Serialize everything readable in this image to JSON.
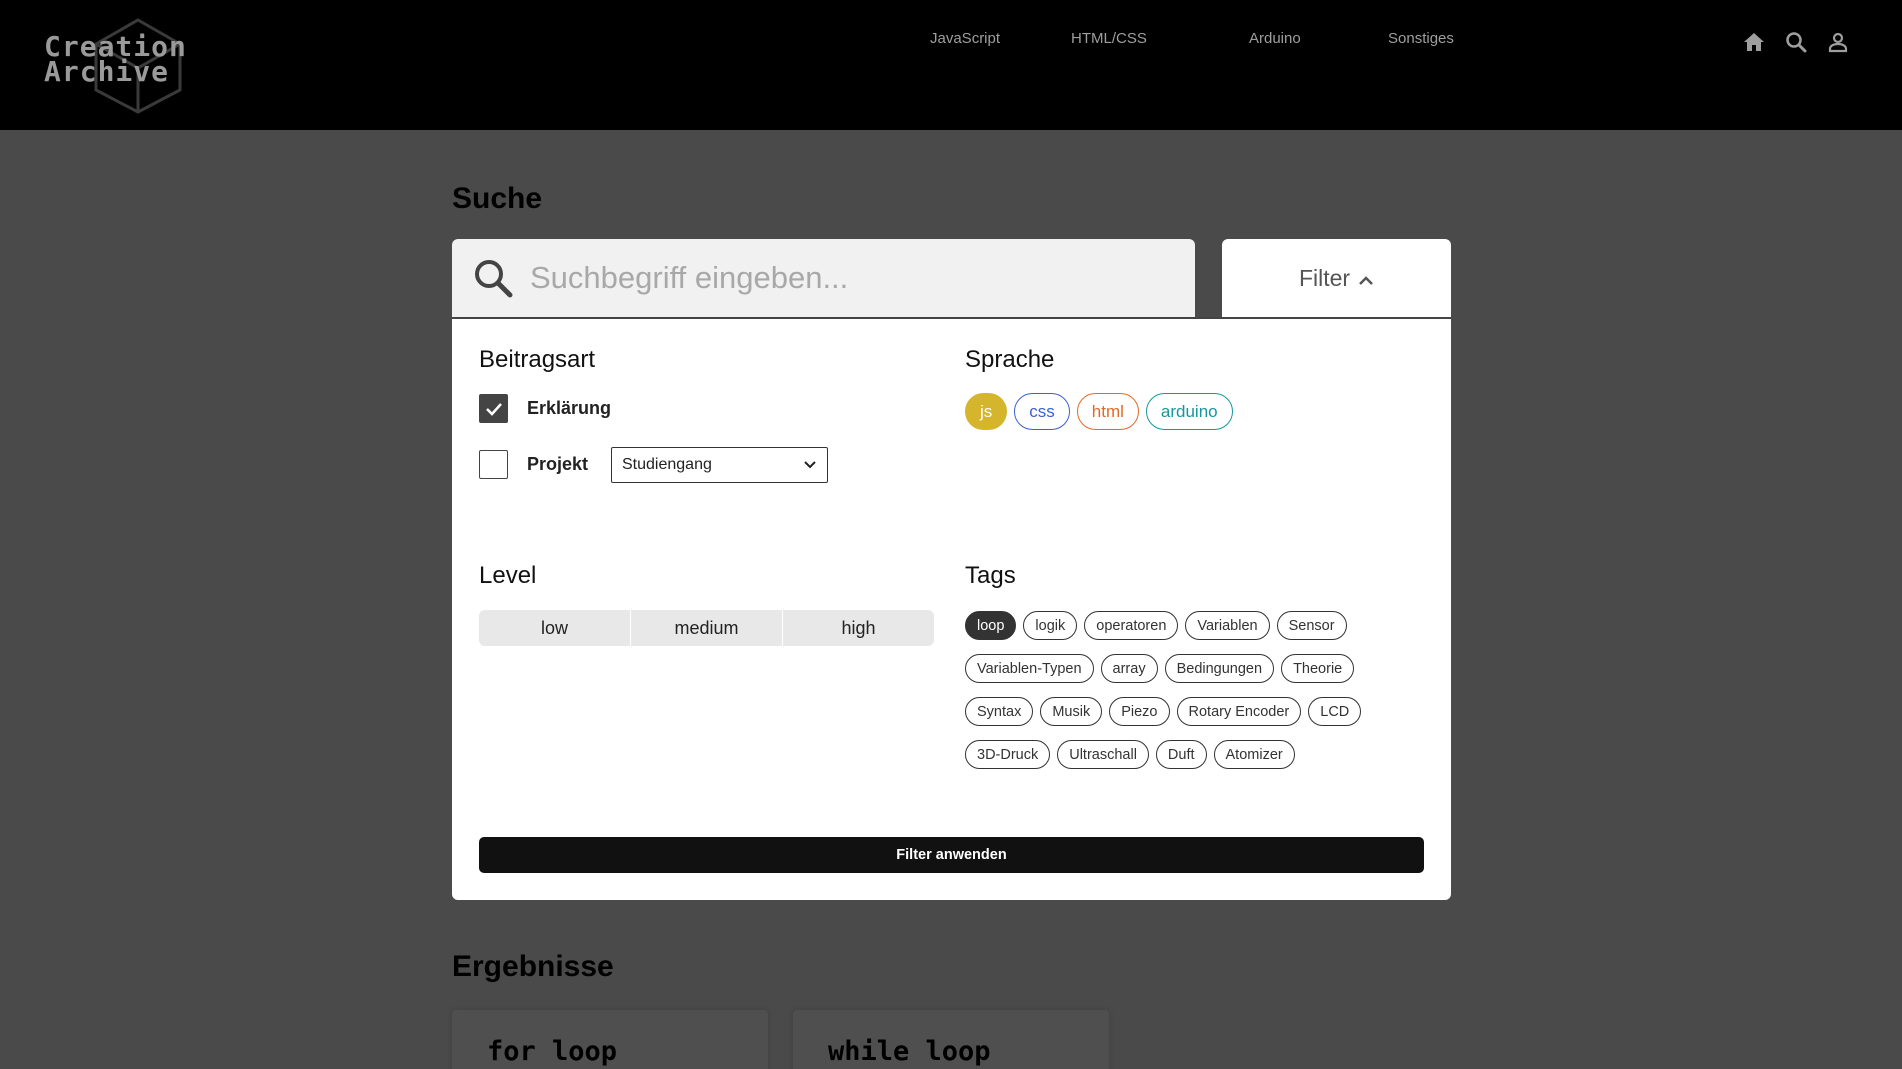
{
  "brand": {
    "line1": "Creation",
    "line2": "Archive"
  },
  "nav": [
    {
      "label": "JavaScript"
    },
    {
      "label": "HTML/CSS"
    },
    {
      "label": "Arduino"
    },
    {
      "label": "Sonstiges"
    }
  ],
  "header_icons": [
    "home-icon",
    "search-icon",
    "user-icon"
  ],
  "search": {
    "title": "Suche",
    "placeholder": "Suchbegriff eingeben...",
    "value": "",
    "filter_label": "Filter"
  },
  "filter": {
    "beitragsart": {
      "heading": "Beitragsart",
      "options": [
        {
          "label": "Erklärung",
          "checked": true
        },
        {
          "label": "Projekt",
          "checked": false
        }
      ],
      "select_value": "Studiengang"
    },
    "sprache": {
      "heading": "Sprache",
      "pills": [
        {
          "label": "js",
          "color": "#d4b52c",
          "filled": true
        },
        {
          "label": "css",
          "color": "#3b5fcf",
          "filled": false
        },
        {
          "label": "html",
          "color": "#e26a25",
          "filled": false
        },
        {
          "label": "arduino",
          "color": "#18979b",
          "filled": false
        }
      ]
    },
    "level": {
      "heading": "Level",
      "options": [
        "low",
        "medium",
        "high"
      ]
    },
    "tags": {
      "heading": "Tags",
      "rows": [
        [
          "loop",
          "logik",
          "operatoren",
          "Variablen",
          "Sensor"
        ],
        [
          "Variablen-Typen",
          "array",
          "Bedingungen",
          "Theorie"
        ],
        [
          "Syntax",
          "Musik",
          "Piezo",
          "Rotary Encoder",
          "LCD"
        ],
        [
          "3D-Druck",
          "Ultraschall",
          "Duft",
          "Atomizer"
        ]
      ],
      "active": "loop"
    },
    "apply_label": "Filter anwenden"
  },
  "results": {
    "title": "Ergebnisse",
    "cards": [
      {
        "title": "for loop"
      },
      {
        "title": "while loop"
      }
    ]
  }
}
